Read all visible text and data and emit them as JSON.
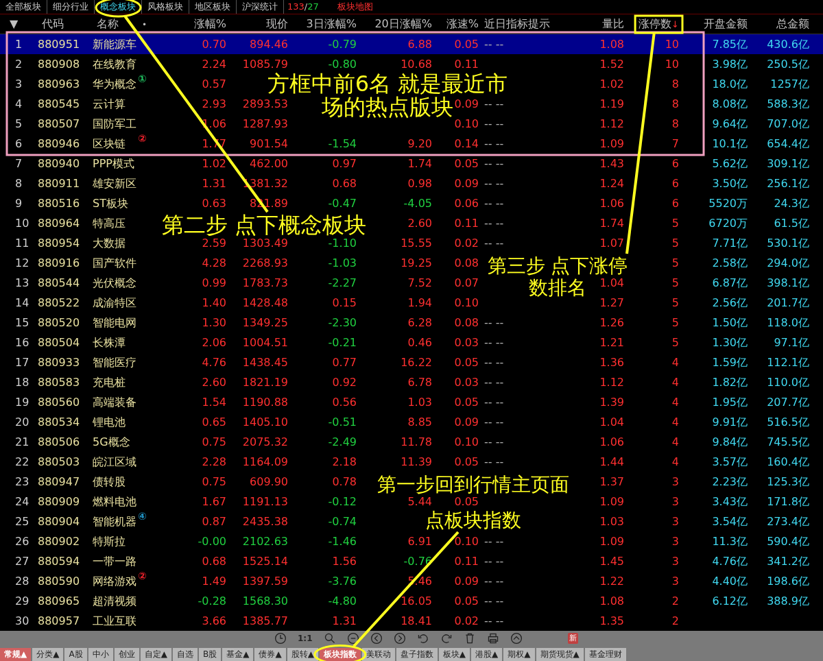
{
  "top_tabs": [
    {
      "label": "全部板块",
      "selected": false
    },
    {
      "label": "细分行业",
      "selected": false
    },
    {
      "label": "概念板块",
      "selected": true
    },
    {
      "label": "风格板块",
      "selected": false
    },
    {
      "label": "地区板块",
      "selected": false
    },
    {
      "label": "沪深统计",
      "selected": false
    }
  ],
  "counts": {
    "up": "133",
    "separator": "/",
    "down": "27"
  },
  "map_link": "板块地图",
  "columns": [
    {
      "label": "▼",
      "kind": "menu"
    },
    {
      "label": "代码",
      "kind": "text"
    },
    {
      "label": "名称",
      "kind": "text",
      "mark": "•"
    },
    {
      "label": "涨幅%",
      "kind": "num"
    },
    {
      "label": "现价",
      "kind": "num"
    },
    {
      "label": "3日涨幅%",
      "kind": "num"
    },
    {
      "label": "20日涨幅%",
      "kind": "num"
    },
    {
      "label": "涨速%",
      "kind": "num"
    },
    {
      "label": "近日指标提示",
      "kind": "text"
    },
    {
      "label": "量比",
      "kind": "num"
    },
    {
      "label": "涨停数",
      "kind": "num",
      "sorted": true,
      "sort_mark": "↓"
    },
    {
      "label": "开盘金额",
      "kind": "num"
    },
    {
      "label": "总金额",
      "kind": "num"
    }
  ],
  "rows": [
    {
      "no": "1",
      "code": "880951",
      "name": "新能源车",
      "pct": "0.70",
      "price": "894.46",
      "up": true,
      "chg3d": "-0.79",
      "up_3d": false,
      "chg20d": "6.88",
      "up_20d": true,
      "speed": "0.05",
      "hint": "-- --",
      "ratio": "1.08",
      "limit_ups": "10",
      "open_amt": "7.85亿",
      "total_amt": "430.6亿",
      "selected": true
    },
    {
      "no": "2",
      "code": "880908",
      "name": "在线教育",
      "pct": "2.24",
      "price": "1085.79",
      "up": true,
      "chg3d": "-0.80",
      "up_3d": false,
      "chg20d": "10.68",
      "up_20d": true,
      "speed": "0.11",
      "ratio": "1.52",
      "limit_ups": "10",
      "open_amt": "3.98亿",
      "total_amt": "250.5亿",
      "selected": false
    },
    {
      "no": "3",
      "code": "880963",
      "name": "华为概念",
      "badge": {
        "text": "①",
        "color": "#20c060"
      },
      "pct": "0.57",
      "up": true,
      "ratio": "1.02",
      "limit_ups": "8",
      "open_amt": "18.0亿",
      "total_amt": "1257亿",
      "selected": false
    },
    {
      "no": "4",
      "code": "880545",
      "name": "云计算",
      "pct": "2.93",
      "price": "2893.53",
      "up": true,
      "speed": "0.09",
      "hint": "-- --",
      "ratio": "1.19",
      "limit_ups": "8",
      "open_amt": "8.08亿",
      "total_amt": "588.3亿",
      "selected": false
    },
    {
      "no": "5",
      "code": "880507",
      "name": "国防军工",
      "pct": "1.06",
      "price": "1287.93",
      "up": true,
      "speed": "0.10",
      "hint": "-- --",
      "ratio": "1.12",
      "limit_ups": "8",
      "open_amt": "9.64亿",
      "total_amt": "707.0亿",
      "selected": false
    },
    {
      "no": "6",
      "code": "880946",
      "name": "区块链",
      "badge": {
        "text": "②",
        "color": "#e8202a"
      },
      "pct": "1.77",
      "price": "901.54",
      "up": true,
      "chg3d": "-1.54",
      "up_3d": false,
      "chg20d": "9.20",
      "up_20d": true,
      "speed": "0.14",
      "hint": "-- --",
      "ratio": "1.09",
      "limit_ups": "7",
      "open_amt": "10.1亿",
      "total_amt": "654.4亿",
      "selected": false
    },
    {
      "no": "7",
      "code": "880940",
      "name": "PPP模式",
      "pct": "1.02",
      "price": "462.00",
      "up": true,
      "chg3d": "0.97",
      "up_3d": true,
      "chg20d": "1.74",
      "up_20d": true,
      "speed": "0.05",
      "hint": "-- --",
      "ratio": "1.43",
      "limit_ups": "6",
      "open_amt": "5.62亿",
      "total_amt": "309.1亿",
      "selected": false
    },
    {
      "no": "8",
      "code": "880911",
      "name": "雄安新区",
      "pct": "1.31",
      "price": "1381.32",
      "up": true,
      "chg3d": "0.68",
      "up_3d": true,
      "chg20d": "0.98",
      "up_20d": true,
      "speed": "0.09",
      "hint": "-- --",
      "ratio": "1.24",
      "limit_ups": "6",
      "open_amt": "3.50亿",
      "total_amt": "256.1亿",
      "selected": false
    },
    {
      "no": "9",
      "code": "880516",
      "name": "ST板块",
      "pct": "0.63",
      "price": "821.89",
      "up": true,
      "chg3d": "-0.47",
      "up_3d": false,
      "chg20d": "-4.05",
      "up_20d": false,
      "speed": "0.06",
      "hint": "-- --",
      "ratio": "1.06",
      "limit_ups": "6",
      "open_amt": "5520万",
      "total_amt": "24.3亿",
      "selected": false
    },
    {
      "no": "10",
      "code": "880964",
      "name": "特高压",
      "chg20d": "2.60",
      "up_20d": true,
      "speed": "0.11",
      "hint": "-- --",
      "ratio": "1.74",
      "limit_ups": "5",
      "open_amt": "6720万",
      "total_amt": "61.5亿",
      "selected": false
    },
    {
      "no": "11",
      "code": "880954",
      "name": "大数据",
      "pct": "2.59",
      "price": "1303.49",
      "up": true,
      "chg3d": "-1.10",
      "up_3d": false,
      "chg20d": "15.55",
      "up_20d": true,
      "speed": "0.02",
      "hint": "-- --",
      "ratio": "1.07",
      "limit_ups": "5",
      "open_amt": "7.71亿",
      "total_amt": "530.1亿",
      "selected": false
    },
    {
      "no": "12",
      "code": "880916",
      "name": "国产软件",
      "pct": "4.28",
      "price": "2268.93",
      "up": true,
      "chg3d": "-1.03",
      "up_3d": false,
      "chg20d": "19.25",
      "up_20d": true,
      "speed": "0.08",
      "limit_ups": "5",
      "open_amt": "2.58亿",
      "total_amt": "294.0亿",
      "selected": false
    },
    {
      "no": "13",
      "code": "880544",
      "name": "光伏概念",
      "pct": "0.99",
      "price": "1783.73",
      "up": true,
      "chg3d": "-2.27",
      "up_3d": false,
      "chg20d": "7.52",
      "up_20d": true,
      "speed": "0.07",
      "ratio": "1.04",
      "limit_ups": "5",
      "open_amt": "6.87亿",
      "total_amt": "398.1亿",
      "selected": false
    },
    {
      "no": "14",
      "code": "880522",
      "name": "成渝特区",
      "pct": "1.40",
      "price": "1428.48",
      "up": true,
      "chg3d": "0.15",
      "up_3d": true,
      "chg20d": "1.94",
      "up_20d": true,
      "speed": "0.10",
      "ratio": "1.27",
      "limit_ups": "5",
      "open_amt": "2.56亿",
      "total_amt": "201.7亿",
      "selected": false
    },
    {
      "no": "15",
      "code": "880520",
      "name": "智能电网",
      "pct": "1.30",
      "price": "1349.25",
      "up": true,
      "chg3d": "-2.30",
      "up_3d": false,
      "chg20d": "6.28",
      "up_20d": true,
      "speed": "0.08",
      "hint": "-- --",
      "ratio": "1.26",
      "limit_ups": "5",
      "open_amt": "1.50亿",
      "total_amt": "118.0亿",
      "selected": false
    },
    {
      "no": "16",
      "code": "880504",
      "name": "长株潭",
      "pct": "2.06",
      "price": "1004.51",
      "up": true,
      "chg3d": "-0.21",
      "up_3d": false,
      "chg20d": "0.46",
      "up_20d": true,
      "speed": "0.03",
      "hint": "-- --",
      "ratio": "1.21",
      "limit_ups": "5",
      "open_amt": "1.30亿",
      "total_amt": "97.1亿",
      "selected": false
    },
    {
      "no": "17",
      "code": "880933",
      "name": "智能医疗",
      "pct": "4.76",
      "price": "1438.45",
      "up": true,
      "chg3d": "0.77",
      "up_3d": true,
      "chg20d": "16.22",
      "up_20d": true,
      "speed": "0.05",
      "hint": "-- --",
      "ratio": "1.36",
      "limit_ups": "4",
      "open_amt": "1.59亿",
      "total_amt": "112.1亿",
      "selected": false
    },
    {
      "no": "18",
      "code": "880583",
      "name": "充电桩",
      "pct": "2.60",
      "price": "1821.19",
      "up": true,
      "chg3d": "0.92",
      "up_3d": true,
      "chg20d": "6.78",
      "up_20d": true,
      "speed": "0.03",
      "hint": "-- --",
      "ratio": "1.12",
      "limit_ups": "4",
      "open_amt": "1.82亿",
      "total_amt": "110.0亿",
      "selected": false
    },
    {
      "no": "19",
      "code": "880560",
      "name": "高端装备",
      "pct": "1.54",
      "price": "1190.88",
      "up": true,
      "chg3d": "0.56",
      "up_3d": true,
      "chg20d": "1.03",
      "up_20d": true,
      "speed": "0.05",
      "hint": "-- --",
      "ratio": "1.39",
      "limit_ups": "4",
      "open_amt": "1.95亿",
      "total_amt": "207.7亿",
      "selected": false
    },
    {
      "no": "20",
      "code": "880534",
      "name": "锂电池",
      "pct": "0.65",
      "price": "1405.10",
      "up": true,
      "chg3d": "-0.51",
      "up_3d": false,
      "chg20d": "8.85",
      "up_20d": true,
      "speed": "0.09",
      "hint": "-- --",
      "ratio": "1.04",
      "limit_ups": "4",
      "open_amt": "9.91亿",
      "total_amt": "516.5亿",
      "selected": false
    },
    {
      "no": "21",
      "code": "880506",
      "name": "5G概念",
      "pct": "0.75",
      "price": "2075.32",
      "up": true,
      "chg3d": "-2.49",
      "up_3d": false,
      "chg20d": "11.78",
      "up_20d": true,
      "speed": "0.10",
      "hint": "-- --",
      "ratio": "1.06",
      "limit_ups": "4",
      "open_amt": "9.84亿",
      "total_amt": "745.5亿",
      "selected": false
    },
    {
      "no": "22",
      "code": "880503",
      "name": "皖江区域",
      "pct": "2.28",
      "price": "1164.09",
      "up": true,
      "chg3d": "2.18",
      "up_3d": true,
      "chg20d": "11.39",
      "up_20d": true,
      "speed": "0.05",
      "hint": "-- --",
      "ratio": "1.44",
      "limit_ups": "4",
      "open_amt": "3.57亿",
      "total_amt": "160.4亿",
      "selected": false
    },
    {
      "no": "23",
      "code": "880947",
      "name": "债转股",
      "pct": "0.75",
      "price": "609.90",
      "up": true,
      "chg3d": "0.78",
      "up_3d": true,
      "ratio": "1.37",
      "limit_ups": "3",
      "open_amt": "2.23亿",
      "total_amt": "125.3亿",
      "selected": false
    },
    {
      "no": "24",
      "code": "880909",
      "name": "燃料电池",
      "pct": "1.67",
      "price": "1191.13",
      "up": true,
      "chg3d": "-0.12",
      "up_3d": false,
      "chg20d": "5.44",
      "up_20d": true,
      "speed": "0.05",
      "ratio": "1.09",
      "limit_ups": "3",
      "open_amt": "3.43亿",
      "total_amt": "171.8亿",
      "selected": false
    },
    {
      "no": "25",
      "code": "880904",
      "name": "智能机器",
      "badge": {
        "text": "④",
        "color": "#2090c0"
      },
      "pct": "0.87",
      "price": "2435.38",
      "up": true,
      "chg3d": "-0.74",
      "up_3d": false,
      "ratio": "1.03",
      "limit_ups": "3",
      "open_amt": "3.54亿",
      "total_amt": "273.4亿",
      "selected": false
    },
    {
      "no": "26",
      "code": "880902",
      "name": "特斯拉",
      "pct": "-0.00",
      "price": "2102.63",
      "up": false,
      "chg3d": "-1.46",
      "up_3d": false,
      "chg20d": "6.91",
      "up_20d": true,
      "speed": "0.10",
      "hint": "-- --",
      "ratio": "1.09",
      "limit_ups": "3",
      "open_amt": "11.3亿",
      "total_amt": "590.4亿",
      "selected": false
    },
    {
      "no": "27",
      "code": "880594",
      "name": "一带一路",
      "pct": "0.68",
      "price": "1525.14",
      "up": true,
      "chg3d": "1.56",
      "up_3d": true,
      "chg20d": "-0.76",
      "up_20d": false,
      "speed": "0.11",
      "hint": "-- --",
      "ratio": "1.45",
      "limit_ups": "3",
      "open_amt": "4.76亿",
      "total_amt": "341.2亿",
      "selected": false
    },
    {
      "no": "28",
      "code": "880590",
      "name": "网络游戏",
      "badge": {
        "text": "②",
        "color": "#e8202a"
      },
      "pct": "1.49",
      "price": "1397.59",
      "up": true,
      "chg3d": "-3.76",
      "up_3d": false,
      "chg20d": "5.46",
      "up_20d": true,
      "speed": "0.09",
      "hint": "-- --",
      "ratio": "1.22",
      "limit_ups": "3",
      "open_amt": "4.40亿",
      "total_amt": "198.6亿",
      "selected": false
    },
    {
      "no": "29",
      "code": "880965",
      "name": "超清视频",
      "pct": "-0.28",
      "price": "1568.30",
      "up": false,
      "chg3d": "-4.80",
      "up_3d": false,
      "chg20d": "16.05",
      "up_20d": true,
      "speed": "0.05",
      "hint": "-- --",
      "ratio": "1.08",
      "limit_ups": "2",
      "open_amt": "6.12亿",
      "total_amt": "388.9亿",
      "selected": false
    },
    {
      "no": "30",
      "code": "880957",
      "name": "工业互联",
      "pct": "3.66",
      "price": "1385.77",
      "up": true,
      "chg3d": "1.31",
      "up_3d": true,
      "chg20d": "18.41",
      "up_20d": true,
      "speed": "0.02",
      "hint": "-- --",
      "ratio": "1.35",
      "limit_ups": "2",
      "selected": false
    }
  ],
  "toolbar": {
    "ratio_label": "1:1",
    "new_badge": "新"
  },
  "bottom_tabs": [
    {
      "label": "常规▲",
      "selected": true
    },
    {
      "label": "分类▲",
      "selected": false
    },
    {
      "label": "A股",
      "selected": false
    },
    {
      "label": "中小",
      "selected": false
    },
    {
      "label": "创业",
      "selected": false
    },
    {
      "label": "自定▲",
      "selected": false
    },
    {
      "label": "自选",
      "selected": false
    },
    {
      "label": "B股",
      "selected": false
    },
    {
      "label": "基金▲",
      "selected": false
    },
    {
      "label": "债券▲",
      "selected": false
    },
    {
      "label": "股转▲",
      "selected": false
    },
    {
      "label": "板块指数",
      "selected": true
    },
    {
      "label": "美联动",
      "selected": false
    },
    {
      "label": "盘子指数",
      "selected": false
    },
    {
      "label": "板块▲",
      "selected": false
    },
    {
      "label": "港股▲",
      "selected": false
    },
    {
      "label": "期权▲",
      "selected": false
    },
    {
      "label": "期货现货▲",
      "selected": false
    },
    {
      "label": "基金理财",
      "selected": false
    }
  ],
  "annotations": [
    {
      "lines": [
        "方框中前6名 就是最近市",
        "场的热点版块"
      ]
    },
    {
      "lines": [
        "第二步 点下概念板块"
      ]
    },
    {
      "lines": [
        "第三步 点下涨停",
        "数排名"
      ]
    },
    {
      "lines": [
        "第一步回到行情主页面",
        "点板块指数"
      ]
    }
  ]
}
